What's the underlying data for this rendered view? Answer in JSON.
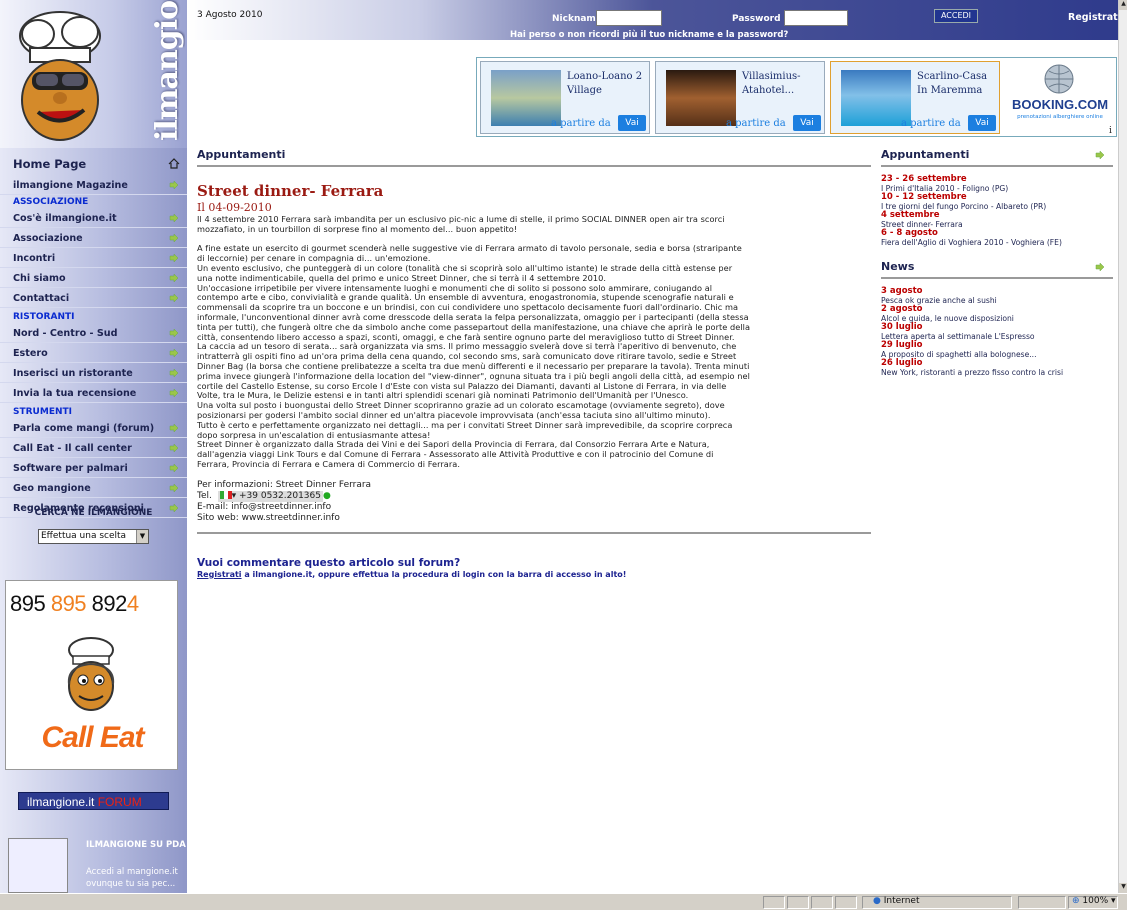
{
  "header": {
    "date": "3 Agosto 2010",
    "nickname_label": "Nickname",
    "password_label": "Password",
    "login_button": "ACCEDI",
    "register_link": "Registrati",
    "forgot_text": "Hai perso o non ricordi più il tuo nickname e la password?"
  },
  "logo": {
    "text": "ilmangione.it"
  },
  "nav": {
    "home": "Home Page",
    "magazine": "ilmangione Magazine",
    "sections": [
      {
        "title": "ASSOCIAZIONE",
        "items": [
          "Cos'è ilmangione.it",
          "Associazione",
          "Incontri",
          "Chi siamo",
          "Contattaci"
        ]
      },
      {
        "title": "RISTORANTI",
        "items": [
          "Nord - Centro - Sud",
          "Estero",
          "Inserisci un ristorante",
          "Invia la tua recensione"
        ]
      },
      {
        "title": "STRUMENTI",
        "items": [
          "Parla come mangi (forum)",
          "Call Eat - Il call center",
          "Software per palmari",
          "Geo mangione",
          "Regolamento recensioni"
        ]
      }
    ]
  },
  "search": {
    "title": "CERCA NE ILMANGIONE",
    "select_value": "Effettua una scelta"
  },
  "callcenter": {
    "phone_a": "895 ",
    "phone_b": "895",
    "phone_c": " 892",
    "phone_d": "4",
    "label": "Call Eat"
  },
  "forum_button": {
    "text": "ilmangione.it ",
    "red": "FORUM"
  },
  "pda": {
    "title": "ILMANGIONE SU PDA",
    "text": "Accedi al mangione.it ovunque tu sia pec..."
  },
  "banner": {
    "hotels": [
      {
        "name": "Loano-Loano 2 Village",
        "price_label": "a partire da",
        "button": "Vai"
      },
      {
        "name": "Villasimius-Atahotel...",
        "price_label": "a partire da",
        "button": "Vai"
      },
      {
        "name": "Scarlino-Casa In Maremma",
        "price_label": "a partire da",
        "button": "Vai"
      }
    ],
    "booking_logo": "BOOKING.COM",
    "booking_sub": "prenotazioni alberghiere online",
    "info": "i"
  },
  "main": {
    "section_title": "Appuntamenti",
    "article_title": "Street dinner- Ferrara",
    "article_date": "Il 04-09-2010",
    "article_body": "Il 4 settembre 2010 Ferrara sarà imbandita per un esclusivo pic-nic a lume di stelle, il primo SOCIAL DINNER open air tra scorci\nmozzafiato, in un tourbillon di sorprese fino al momento del... buon appetito!\n\nA fine estate un esercito di gourmet scenderà nelle suggestive vie di Ferrara armato di tavolo personale, sedia e borsa (straripante\ndi leccornie) per cenare in compagnia di... un'emozione.\nUn evento esclusivo, che punteggerà di un colore (tonalità che si scoprirà solo all'ultimo istante) le strade della città estense per\nuna notte indimenticabile, quella del primo e unico Street Dinner, che si terrà il 4 settembre 2010.\nUn'occasione irripetibile per vivere intensamente luoghi e monumenti che di solito si possono solo ammirare, coniugando al\ncontempo arte e cibo, convivialità e grande qualità. Un ensemble di avventura, enogastronomia, stupende scenografie naturali e\ncommensali da scoprire tra un boccone e un brindisi, con cui condividere uno spettacolo decisamente fuori dall'ordinario. Chic ma\ninformale, l'unconventional dinner avrà come dresscode della serata la felpa personalizzata, omaggio per i partecipanti (della stessa\ntinta per tutti), che fungerà oltre che da simbolo anche come passepartout della manifestazione, una chiave che aprirà le porte della\ncittà, consentendo libero accesso a spazi, sconti, omaggi, e che farà sentire ognuno parte del meraviglioso tutto di Street Dinner.\nLa caccia ad un tesoro di serata... sarà organizzata via sms. Il primo messaggio svelerà dove si terrà l'aperitivo di benvenuto, che\nintratterrà gli ospiti fino ad un'ora prima della cena quando, col secondo sms, sarà comunicato dove ritirare tavolo, sedie e Street\nDinner Bag (la borsa che contiene prelibatezze a scelta tra due menù differenti e il necessario per preparare la tavola). Trenta minuti\nprima invece giungerà l'informazione della location del \"view-dinner\", ognuna situata tra i più begli angoli della città, ad esempio nel\ncortile del Castello Estense, su corso Ercole I d'Este con vista sul Palazzo dei Diamanti, davanti al Listone di Ferrara, in via delle\nVolte, tra le Mura, le Delizie estensi e in tanti altri splendidi scenari già nominati Patrimonio dell'Umanità per l'Unesco.\nUna volta sul posto i buongustai dello Street Dinner scopriranno grazie ad un colorato escamotage (ovviamente segreto), dove\nposizionarsi per godersi l'ambito social dinner ed un'altra piacevole improvvisata (anch'essa taciuta sino all'ultimo minuto).\nTutto è certo e perfettamente organizzato nei dettagli... ma per i convitati Street Dinner sarà imprevedibile, da scoprire corpreca\ndopo sorpresa in un'escalation di entusiasmante attesa!\nStreet Dinner è organizzato dalla Strada dei Vini e dei Sapori della Provincia di Ferrara, dal Consorzio Ferrara Arte e Natura,\ndall'agenzia viaggi Link Tours e dal Comune di Ferrara - Assessorato alle Attività Produttive e con il patrocinio del Comune di\nFerrara, Provincia di Ferrara e Camera di Commercio di Ferrara.",
    "info_line": "Per informazioni: Street Dinner Ferrara",
    "tel_label": "Tel.",
    "tel_value": "+39 0532.201365",
    "email": "E-mail: info@streetdinner.info",
    "website": "Sito web: www.streetdinner.info",
    "comment_title": "Vuoi commentare questo articolo sul forum?",
    "comment_link": "Registrati",
    "comment_text": " a ilmangione.it, oppure effettua la procedura di login con la barra di accesso in alto!"
  },
  "right": {
    "appuntamenti_title": "Appuntamenti",
    "appuntamenti": [
      {
        "date": "23 - 26 settembre",
        "desc": "I Primi d'Italia 2010 - Foligno (PG)"
      },
      {
        "date": "10 - 12 settembre",
        "desc": "I tre giorni del fungo Porcino - Albareto (PR)"
      },
      {
        "date": "4 settembre",
        "desc": "Street dinner- Ferrara"
      },
      {
        "date": "6 - 8 agosto",
        "desc": "Fiera dell'Aglio di Voghiera 2010 - Voghiera (FE)"
      }
    ],
    "news_title": "News",
    "news": [
      {
        "date": "3 agosto",
        "desc": "Pesca ok grazie anche al sushi"
      },
      {
        "date": "2 agosto",
        "desc": "Alcol e guida, le nuove disposizioni"
      },
      {
        "date": "30 luglio",
        "desc": "Lettera aperta al settimanale L'Espresso"
      },
      {
        "date": "29 luglio",
        "desc": "A proposito di spaghetti alla bolognese..."
      },
      {
        "date": "26 luglio",
        "desc": "New York, ristoranti a prezzo fisso contro la crisi"
      }
    ]
  },
  "statusbar": {
    "zone": "Internet",
    "zoom": "100%"
  }
}
